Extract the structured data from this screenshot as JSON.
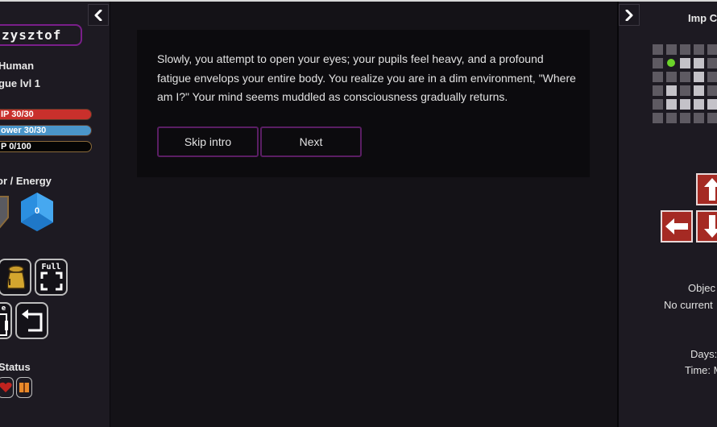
{
  "left_panel": {
    "collapse_icon": "chevron-left-icon",
    "character_name": "zysztof",
    "race": "Human",
    "class_level": "gue lvl 1",
    "bars": {
      "hp": {
        "label": "IP 30/30",
        "value": 30,
        "max": 30,
        "color": "#c9302c"
      },
      "willpower": {
        "label": "ower 30/30",
        "value": 30,
        "max": 30,
        "color": "#4a95c9"
      },
      "xp": {
        "label": "P 0/100",
        "value": 0,
        "max": 100,
        "color": "#050505"
      }
    },
    "armor_energy_title": "or / Energy",
    "armor_icon": "shield-icon",
    "energy_icon": "blue-crystal-icon",
    "energy_value": "0",
    "buttons": [
      {
        "name": "inventory",
        "icon": "bag-icon"
      },
      {
        "name": "fullscreen",
        "icon": "fullscreen-icon",
        "label": "Full"
      },
      {
        "name": "save",
        "icon": "save-icon",
        "label": "e"
      },
      {
        "name": "back",
        "icon": "return-arrow-icon"
      }
    ],
    "status_title": "Status",
    "status_icons": [
      "heart-icon",
      "book-icon"
    ]
  },
  "dialog": {
    "text": "Slowly, you attempt to open your eyes; your pupils feel heavy, and a profound fatigue envelops your entire body. You realize you are in a dim environment, \"Where am I?\" Your mind seems muddled as consciousness gradually returns.",
    "buttons": {
      "skip": "Skip intro",
      "next": "Next"
    },
    "accent_color": "#5a1e63"
  },
  "right_panel": {
    "expand_icon": "chevron-right-icon",
    "title": "Imp C",
    "map": {
      "rows": [
        [
          "d",
          "d",
          "d",
          "d",
          "d"
        ],
        [
          "d",
          "player",
          "l",
          "l",
          "d"
        ],
        [
          "d",
          "d",
          "d",
          "l",
          "d"
        ],
        [
          "d",
          "l",
          "d",
          "l",
          "d"
        ],
        [
          "d",
          "l",
          "l",
          "l",
          "l"
        ],
        [
          "d",
          "d",
          "d",
          "d",
          "d"
        ]
      ],
      "player_color": "#6bd32a"
    },
    "arrows": [
      "up",
      "left",
      "down"
    ],
    "objective_label": "Objec",
    "objective_value": "No current",
    "days_label": "Days:",
    "time_label": "Time: M"
  }
}
